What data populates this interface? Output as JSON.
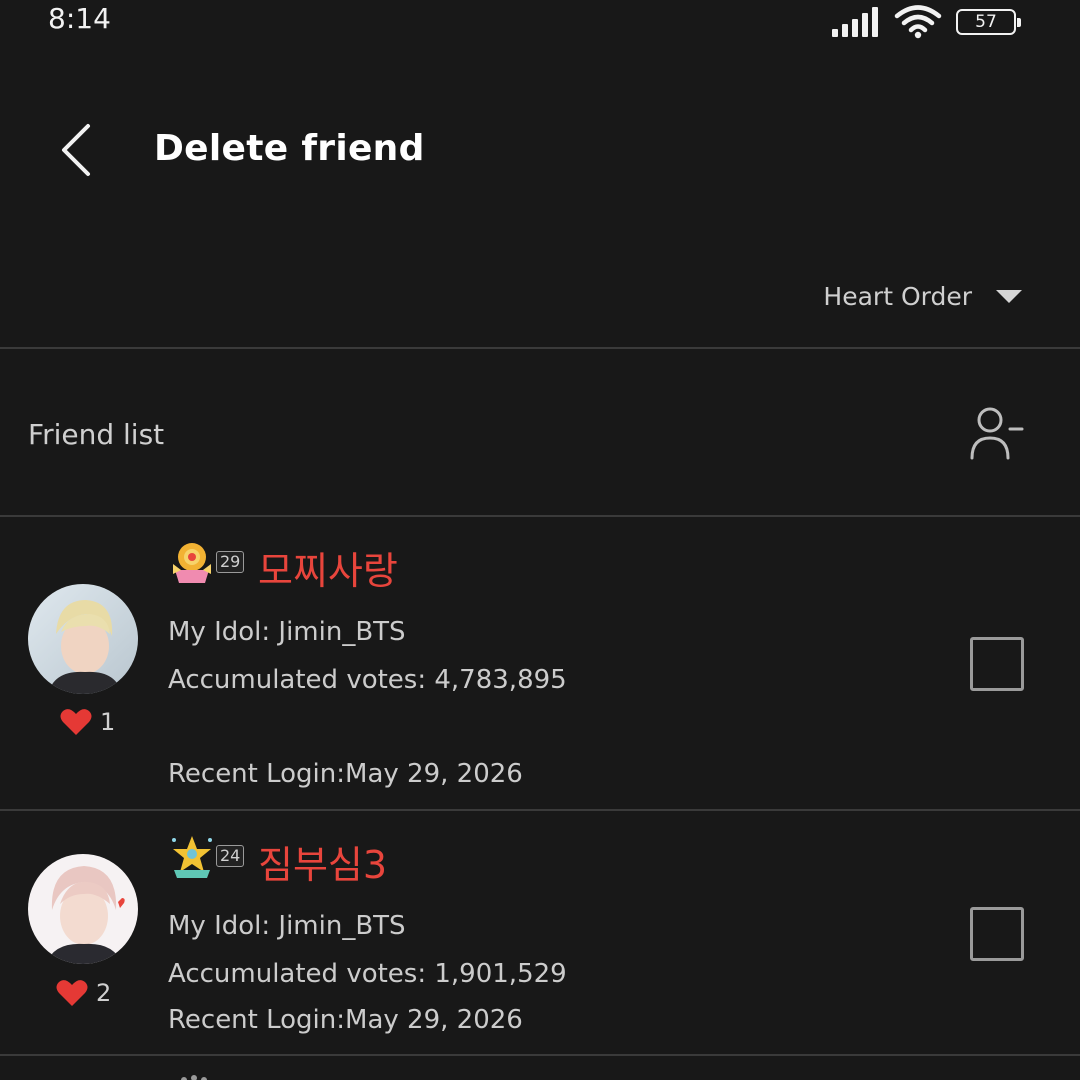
{
  "status_bar": {
    "time": "8:14",
    "battery_level": "57",
    "icons": [
      "signal-icon",
      "wifi-icon",
      "battery-icon"
    ]
  },
  "header": {
    "title": "Delete friend",
    "back_icon": "chevron-left-icon"
  },
  "sort": {
    "label": "Heart Order"
  },
  "friend_list": {
    "title": "Friend list",
    "remove_icon": "person-minus-icon",
    "items": [
      {
        "name": "모찌사랑",
        "level": "29",
        "idol": "My Idol: Jimin_BTS",
        "votes": "Accumulated votes: 4,783,895",
        "recent_login": "Recent Login:May 29, 2026",
        "hearts": "1",
        "checked": false
      },
      {
        "name": "짐부심3",
        "level": "24",
        "idol": "My Idol: Jimin_BTS",
        "votes": "Accumulated votes: 1,901,529",
        "recent_login": "Recent Login:May 29, 2026",
        "hearts": "2",
        "checked": false
      }
    ]
  },
  "colors": {
    "background": "#181818",
    "name_accent": "#e8453c",
    "heart": "#e53935",
    "divider": "#3a3a3a"
  }
}
